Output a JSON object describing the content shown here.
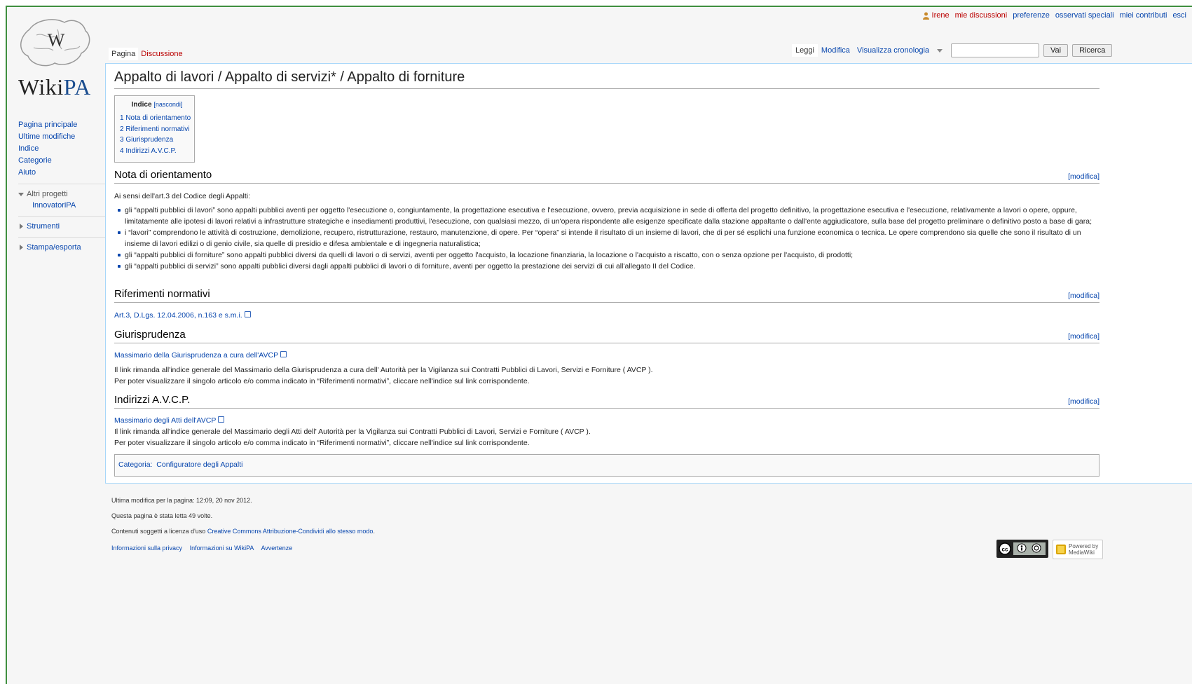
{
  "personal": {
    "user": "Irene",
    "items": [
      "mie discussioni",
      "preferenze",
      "osservati speciali",
      "miei contributi",
      "esci"
    ]
  },
  "logo": {
    "word_a": "Wiki",
    "word_b": "PA",
    "glyph": "W"
  },
  "sidebar": {
    "nav": [
      "Pagina principale",
      "Ultime modifiche",
      "Indice",
      "Categorie",
      "Aiuto"
    ],
    "altri_progetti": {
      "label": "Altri progetti",
      "items": [
        "InnovatoriPA"
      ]
    },
    "strumenti": "Strumenti",
    "stampa": "Stampa/esporta"
  },
  "tabs": {
    "left": [
      "Pagina",
      "Discussione"
    ],
    "right": [
      "Leggi",
      "Modifica",
      "Visualizza cronologia"
    ],
    "search_placeholder": "",
    "go_button": "Vai",
    "search_button": "Ricerca"
  },
  "page": {
    "title": "Appalto di lavori / Appalto di servizi* / Appalto di forniture",
    "toc": {
      "title": "Indice",
      "toggle": "[nascondi]",
      "items": [
        "1 Nota di orientamento",
        "2 Riferimenti normativi",
        "3 Giurisprudenza",
        "4 Indirizzi A.V.C.P."
      ]
    },
    "edit_label": "[modifica]",
    "sections": [
      {
        "heading": "Nota di orientamento"
      },
      {
        "heading": "Riferimenti normativi"
      },
      {
        "heading": "Giurisprudenza"
      },
      {
        "heading": "Indirizzi A.V.C.P."
      }
    ],
    "nota_intro": "Ai sensi dell'art.3 del Codice degli Appalti:",
    "nota_bullets": [
      "gli “appalti pubblici di lavori” sono appalti pubblici aventi per oggetto l'esecuzione o, congiuntamente, la progettazione esecutiva e l'esecuzione, ovvero, previa acquisizione in sede di offerta del progetto definitivo, la progettazione esecutiva e l'esecuzione, relativamente a lavori o opere, oppure, limitatamente alle ipotesi di lavori relativi a infrastrutture strategiche e insediamenti produttivi, l'esecuzione, con qualsiasi mezzo, di un'opera rispondente alle esigenze specificate dalla stazione appaltante o dall'ente aggiudicatore, sulla base del progetto preliminare o definitivo posto a base di gara;",
      "i “lavori” comprendono le attività di costruzione, demolizione, recupero, ristrutturazione, restauro, manutenzione, di opere. Per “opera” si intende il risultato di un insieme di lavori, che di per sé esplichi una funzione economica o tecnica. Le opere comprendono sia quelle che sono il risultato di un insieme di lavori edilizi o di genio civile, sia quelle di presidio e difesa ambientale e di ingegneria naturalistica;",
      "gli “appalti pubblici di forniture” sono appalti pubblici diversi da quelli di lavori o di servizi, aventi per oggetto l'acquisto, la locazione finanziaria, la locazione o l'acquisto a riscatto, con o senza opzione per l'acquisto, di prodotti;",
      "gli “appalti pubblici di servizi” sono appalti pubblici diversi dagli appalti pubblici di lavori o di forniture, aventi per oggetto la prestazione dei servizi di cui all'allegato II del Codice."
    ],
    "riferimenti_link": "Art.3, D.Lgs. 12.04.2006, n.163 e s.m.i.",
    "giur_link": "Massimario della Giurisprudenza a cura dell'AVCP",
    "giur_text_1": "Il link rimanda all'indice generale del Massimario della Giurisprudenza a cura dell' Autorità per la Vigilanza sui Contratti Pubblici di Lavori, Servizi e Forniture ( AVCP ).",
    "giur_text_2": "Per poter visualizzare il singolo articolo e/o comma indicato in “Riferimenti normativi”, cliccare nell'indice sul link corrispondente.",
    "avcp_link": "Massimario degli Atti dell'AVCP",
    "avcp_text_1": "Il link rimanda all'indice generale del Massimario degli Atti dell' Autorità per la Vigilanza sui Contratti Pubblici di Lavori, Servizi e Forniture ( AVCP ).",
    "avcp_text_2": "Per poter visualizzare il singolo articolo e/o comma indicato in “Riferimenti normativi”, cliccare nell'indice sul link corrispondente.",
    "category_label": "Categoria:",
    "category_link": "Configuratore degli Appalti"
  },
  "footer": {
    "last_mod": "Ultima modifica per la pagina: 12:09, 20 nov 2012.",
    "views": "Questa pagina è stata letta 49 volte.",
    "license_prefix": "Contenuti soggetti a licenza d'uso",
    "license_link": "Creative Commons Attribuzione-Condividi allo stesso modo",
    "places": [
      "Informazioni sulla privacy",
      "Informazioni su WikiPA",
      "Avvertenze"
    ],
    "powered_by": "Powered by MediaWiki"
  },
  "colors": {
    "link": "#0645ad",
    "new_link": "#ba0000",
    "frame": "#3f8f3f",
    "content_border": "#a7d7f9"
  }
}
